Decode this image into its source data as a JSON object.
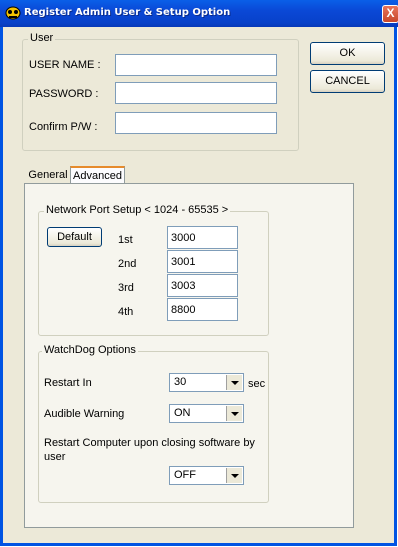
{
  "window": {
    "title": "Register Admin User & Setup Option",
    "close_glyph": "X"
  },
  "user_group": {
    "title": "User",
    "username_label": "USER NAME :",
    "username_value": "",
    "password_label": "PASSWORD :",
    "password_value": "",
    "confirm_label": "Confirm P/W :",
    "confirm_value": ""
  },
  "buttons": {
    "ok": "OK",
    "cancel": "CANCEL"
  },
  "tabs": [
    {
      "label": "General",
      "active": false
    },
    {
      "label": "Advanced",
      "active": true
    }
  ],
  "network": {
    "title": "Network Port Setup < 1024 - 65535 >",
    "default_button": "Default",
    "ports": [
      {
        "label": "1st",
        "value": "3000"
      },
      {
        "label": "2nd",
        "value": "3001"
      },
      {
        "label": "3rd",
        "value": "3003"
      },
      {
        "label": "4th",
        "value": "8800"
      }
    ]
  },
  "watchdog": {
    "title": "WatchDog Options",
    "restart_in_label": "Restart In",
    "restart_in_value": "30",
    "restart_in_unit": "sec",
    "audible_label": "Audible Warning",
    "audible_value": "ON",
    "restart_computer_label": "Restart Computer upon closing software by user",
    "restart_computer_value": "OFF"
  },
  "icons": {
    "title_icon": "app-icon",
    "close_icon": "close-icon",
    "dropdown_icon": "chevron-down-icon"
  }
}
